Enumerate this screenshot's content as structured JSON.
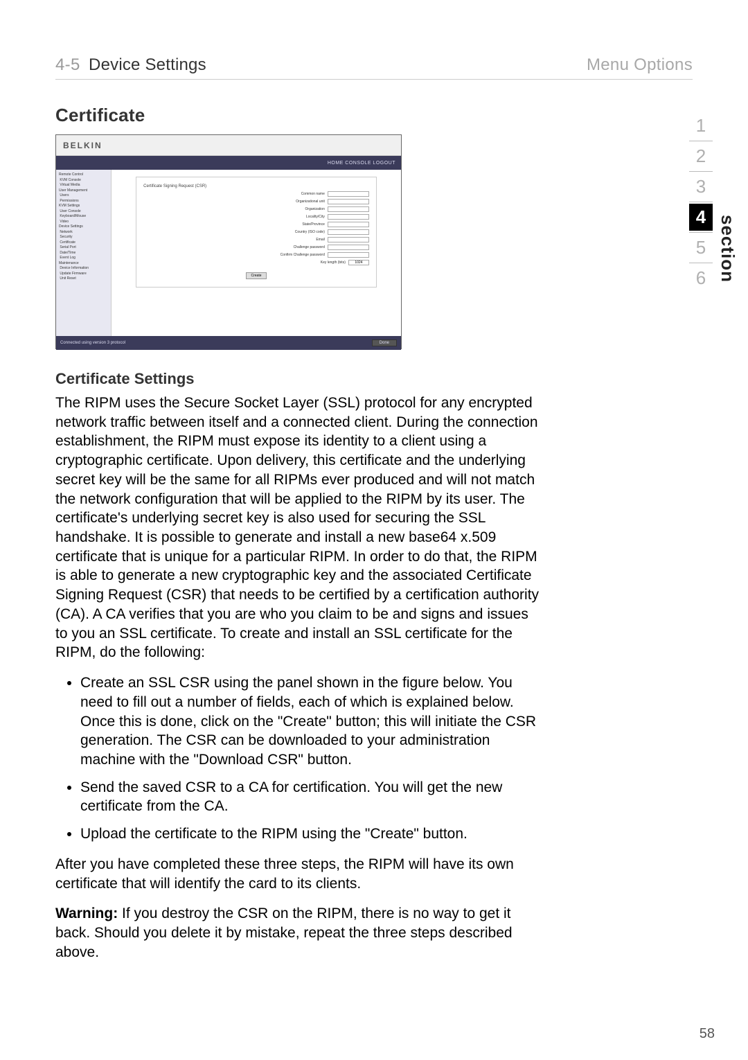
{
  "header": {
    "section_num": "4-5",
    "section_title": "Device Settings",
    "menu_options": "Menu Options"
  },
  "headings": {
    "certificate": "Certificate",
    "cert_settings": "Certificate Settings"
  },
  "screenshot": {
    "logo": "BELKIN",
    "topbar_right": "HOME  CONSOLE  LOGOUT",
    "panel_title": "Certificate Signing Request (CSR)",
    "fields": {
      "common_name": "Common name",
      "org_unit": "Organizational unit",
      "organization": "Organization",
      "locality": "Locality/City",
      "state": "State/Province",
      "country": "Country (ISO code)",
      "email": "Email",
      "cpw": "Challenge password",
      "confirm": "Confirm Challenge password",
      "key_len": "Key length (bits)",
      "key_len_val": "1024"
    },
    "create_btn": "Create",
    "footer_left": "Connected using version 3 protocol",
    "footer_right": "Done"
  },
  "body": {
    "para1": "The RIPM uses the Secure Socket Layer (SSL) protocol for any encrypted network traffic between itself and a connected client. During the connection establishment, the RIPM must expose its identity to a client using a cryptographic certificate. Upon delivery, this certificate and the underlying secret key will be the same for all RIPMs ever produced and will not match the network configuration that will be applied to the RIPM by its user. The certificate's underlying secret key is also used for securing the SSL handshake. It is possible to generate and install a new base64 x.509 certificate that is unique for a particular RIPM. In order to do that, the RIPM is able to generate a new cryptographic key and the associated Certificate Signing Request (CSR) that needs to be certified by a certification authority (CA). A CA verifies that you are who you claim to be and signs and issues to you an SSL certificate. To create and install an SSL certificate for the RIPM, do the following:",
    "bullets": [
      "Create an SSL CSR using the panel shown in the figure below. You need to fill out a number of fields, each of which is explained below. Once this is done, click on the \"Create\" button; this will initiate the CSR generation. The CSR can be downloaded to your administration machine with the \"Download CSR\" button.",
      "Send the saved CSR to a CA for certification. You will get the new certificate from the CA.",
      "Upload the certificate to the RIPM using the \"Create\" button."
    ],
    "para2": "After you have completed these three steps, the RIPM will have its own certificate that will identify the card to its clients.",
    "warning_label": "Warning:",
    "warning_text": " If you destroy the CSR on the RIPM, there is no way to get it back. Should you delete it by mistake, repeat the three steps described above."
  },
  "nav": {
    "items": [
      "1",
      "2",
      "3",
      "4",
      "5",
      "6"
    ],
    "active_index": 3,
    "label": "section"
  },
  "page_number": "58"
}
